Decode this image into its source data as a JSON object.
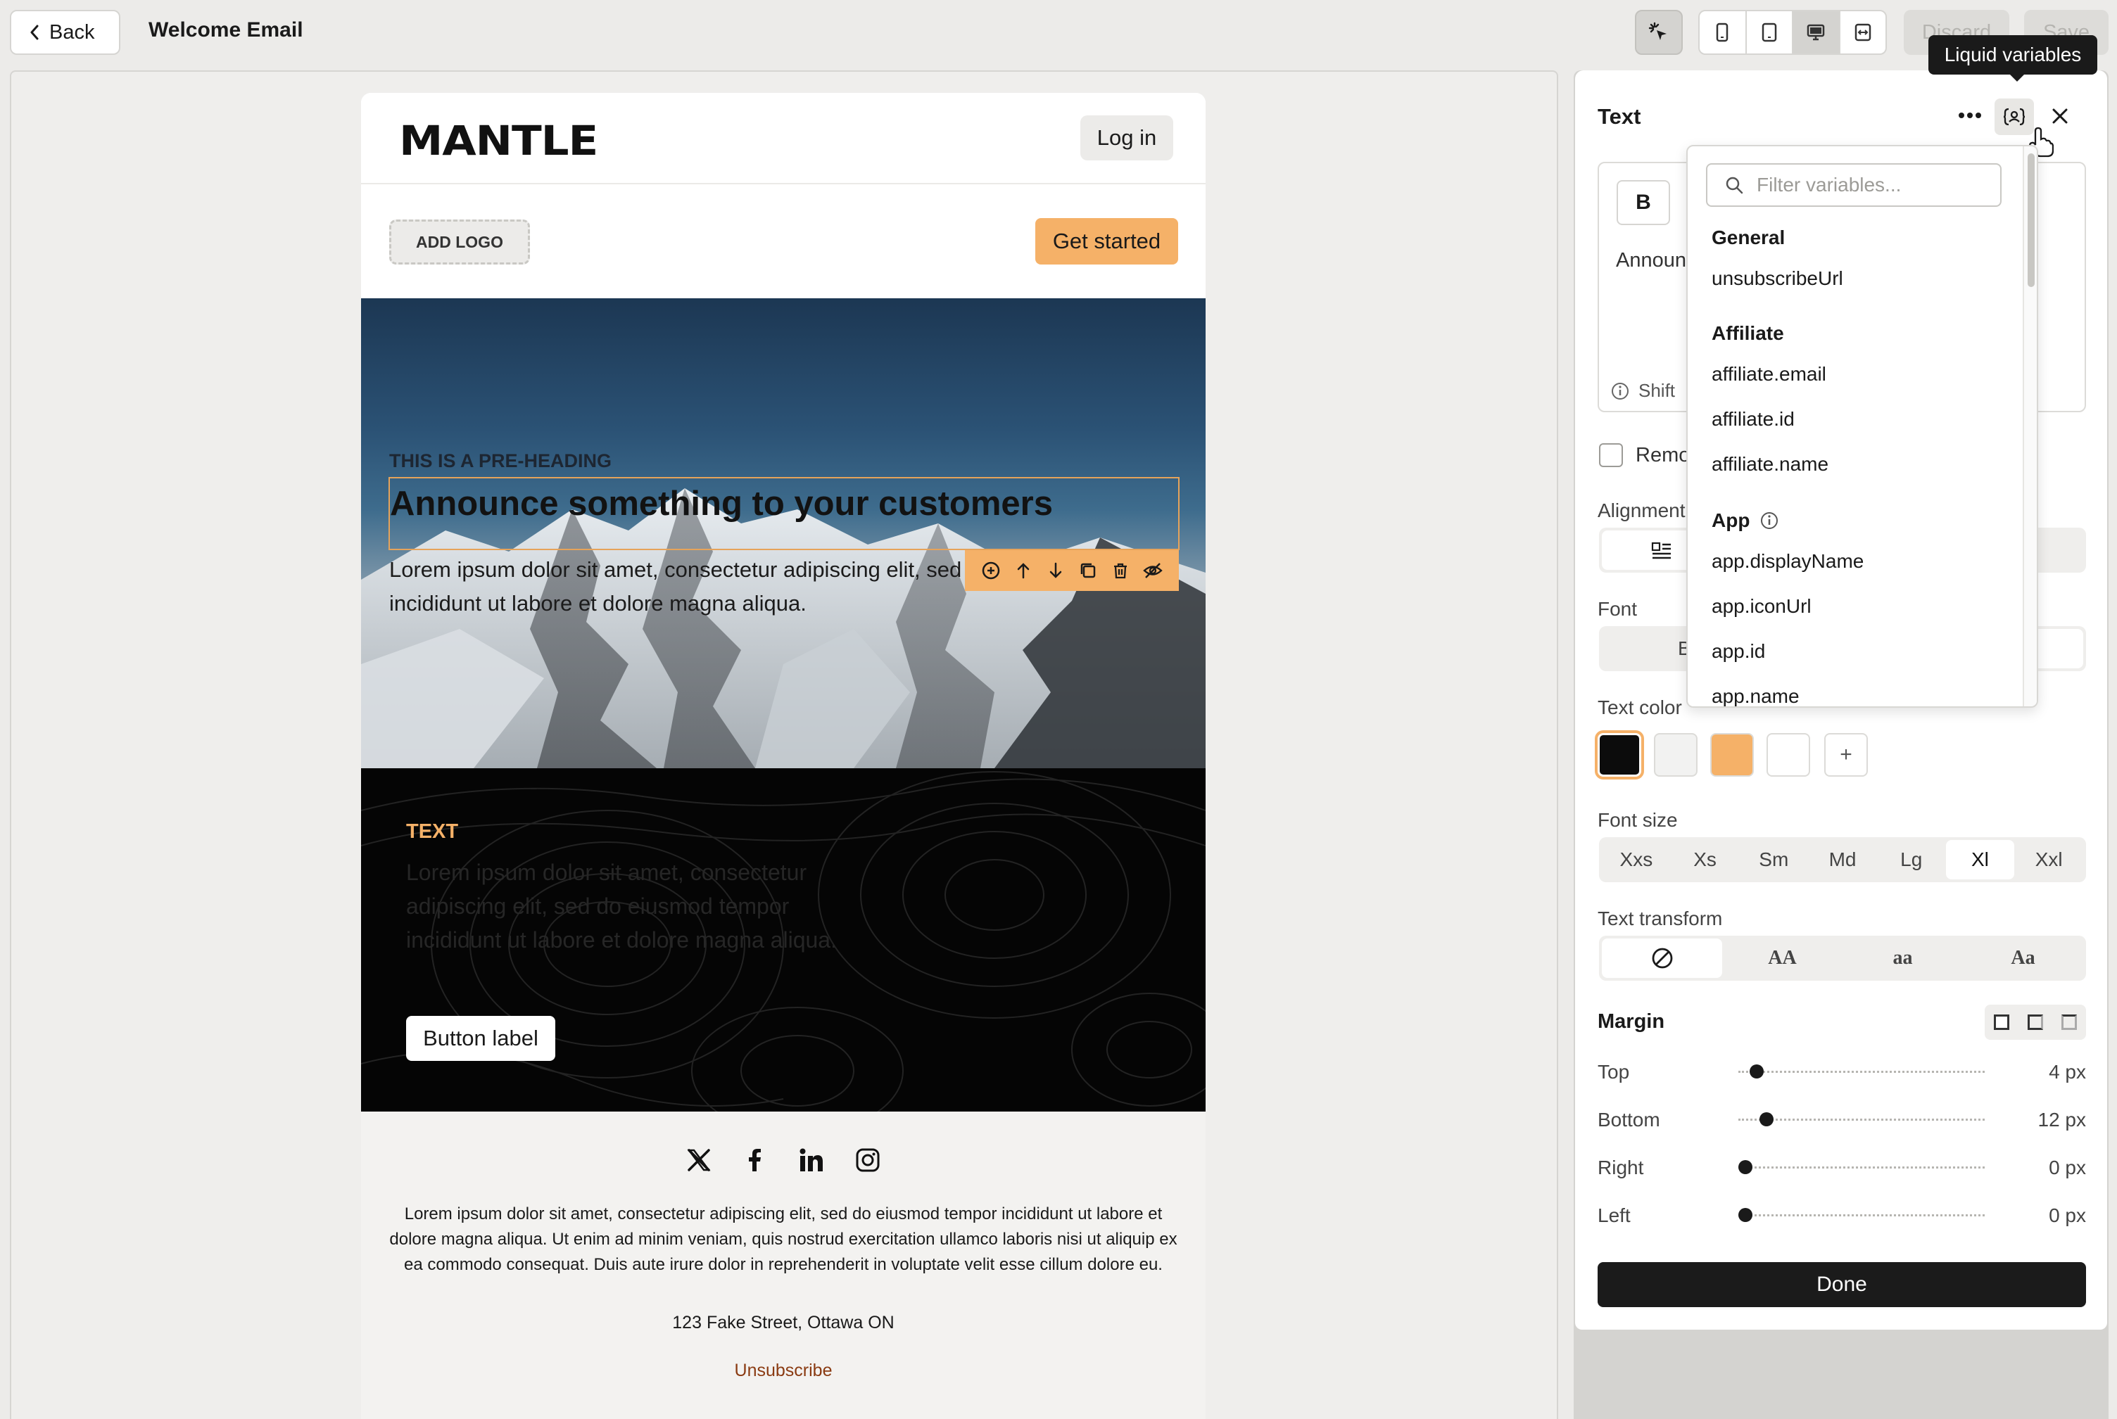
{
  "topbar": {
    "back_label": "Back",
    "title": "Welcome Email",
    "discard_label": "Discard",
    "save_label": "Save",
    "active_device": "desktop",
    "devices": [
      "mobile-icon",
      "tablet-icon",
      "desktop-icon",
      "fullwidth-icon"
    ]
  },
  "email": {
    "brand": "MANTLE",
    "login_label": "Log in",
    "add_logo_label": "ADD LOGO",
    "get_started_label": "Get started",
    "hero": {
      "pre_heading": "THIS IS A PRE-HEADING",
      "heading": "Announce something to your customers",
      "body": "Lorem ipsum dolor sit amet, consectetur adipiscing elit, sed do eiusmod tempor incididunt ut labore et dolore magna aliqua."
    },
    "dark": {
      "label": "TEXT",
      "body": "Lorem ipsum dolor sit amet, consectetur adipiscing elit, sed do eiusmod tempor incididunt ut labore et dolore magna aliqua.",
      "button_label": "Button label"
    },
    "footer": {
      "text": "Lorem ipsum dolor sit amet, consectetur adipiscing elit, sed do eiusmod tempor incididunt ut labore et dolore magna aliqua. Ut enim ad minim veniam, quis nostrud exercitation ullamco laboris nisi ut aliquip ex ea commodo consequat. Duis aute irure dolor in reprehenderit in voluptate velit esse cillum dolore eu.",
      "address": "123 Fake Street, Ottawa ON",
      "unsubscribe": "Unsubscribe"
    }
  },
  "panel": {
    "title": "Text",
    "tooltip": "Liquid variables",
    "bold_label": "B",
    "editor_text": "Announ",
    "editor_hint": "Shift",
    "remove_label": "Remo",
    "alignment_label": "Alignment",
    "font_label": "Font",
    "font_value": "B",
    "text_color_label": "Text color",
    "colors": [
      "#0c0c0c",
      "#f2f2f1",
      "#f5b168",
      "#ffffff"
    ],
    "add_color": "+",
    "font_size_label": "Font size",
    "font_sizes": [
      "Xxs",
      "Xs",
      "Sm",
      "Md",
      "Lg",
      "Xl",
      "Xxl"
    ],
    "font_size_selected": "Xl",
    "text_transform_label": "Text transform",
    "text_transforms": [
      "AA",
      "aa",
      "Aa"
    ],
    "margin_label": "Margin",
    "margins": [
      {
        "name": "Top",
        "value": "4 px"
      },
      {
        "name": "Bottom",
        "value": "12 px"
      },
      {
        "name": "Right",
        "value": "0 px"
      },
      {
        "name": "Left",
        "value": "0 px"
      }
    ],
    "done_label": "Done"
  },
  "variables": {
    "placeholder": "Filter variables...",
    "groups": [
      {
        "name": "General",
        "items": [
          "unsubscribeUrl"
        ]
      },
      {
        "name": "Affiliate",
        "items": [
          "affiliate.email",
          "affiliate.id",
          "affiliate.name"
        ]
      },
      {
        "name": "App",
        "items": [
          "app.displayName",
          "app.iconUrl",
          "app.id",
          "app.name"
        ]
      }
    ]
  }
}
